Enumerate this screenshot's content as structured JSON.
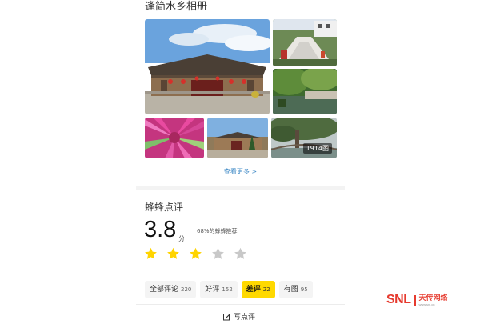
{
  "album": {
    "title": "逢简水乡相册",
    "photo_count_label": "1914图",
    "see_more": "查看更多 >"
  },
  "reviews": {
    "title": "蜂蜂点评",
    "score": "3.8",
    "score_unit": "分",
    "recommend": "68%的蜂蜂推荐",
    "rating": 3,
    "rating_max": 5,
    "filters": [
      {
        "label": "全部评论",
        "count": "220"
      },
      {
        "label": "好评",
        "count": "152"
      },
      {
        "label": "差评",
        "count": "22"
      },
      {
        "label": "有图",
        "count": "95"
      }
    ],
    "write_review": "写点评"
  },
  "watermark": {
    "brand": "SNL",
    "name": "天传网络",
    "url": "www.snl.cn"
  },
  "colors": {
    "star_on": "#ffd400",
    "star_off": "#c8c8c8",
    "active_chip": "#ffd900",
    "link": "#4a90c9",
    "watermark": "#e63a2e"
  }
}
